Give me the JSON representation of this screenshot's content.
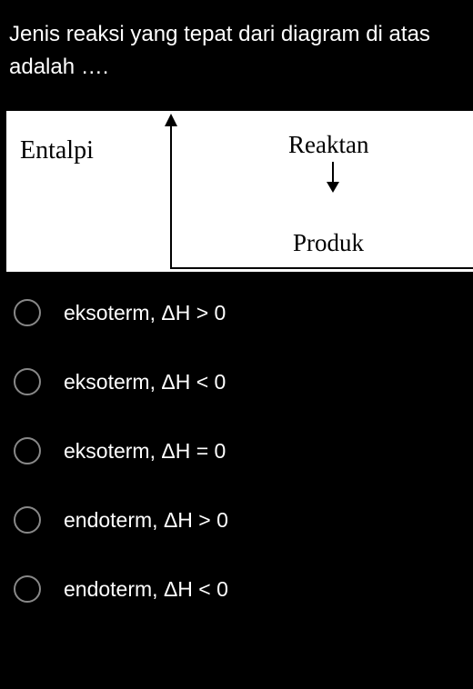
{
  "question": "Jenis reaksi yang tepat dari diagram di atas adalah ….",
  "diagram": {
    "ylabel": "Entalpi",
    "reactant_label": "Reaktan",
    "product_label": "Produk"
  },
  "options": [
    {
      "label": "eksoterm, ΔH > 0"
    },
    {
      "label": "eksoterm, ΔH < 0"
    },
    {
      "label": "eksoterm, ΔH = 0"
    },
    {
      "label": "endoterm, ΔH > 0"
    },
    {
      "label": "endoterm, ΔH < 0"
    }
  ],
  "chart_data": {
    "type": "diagram",
    "description": "Enthalpy diagram showing Reaktan at higher level with downward arrow to Produk at lower level",
    "ylabel": "Entalpi",
    "levels": [
      {
        "name": "Reaktan",
        "relative_height": "high"
      },
      {
        "name": "Produk",
        "relative_height": "low"
      }
    ],
    "arrow_direction": "down"
  }
}
